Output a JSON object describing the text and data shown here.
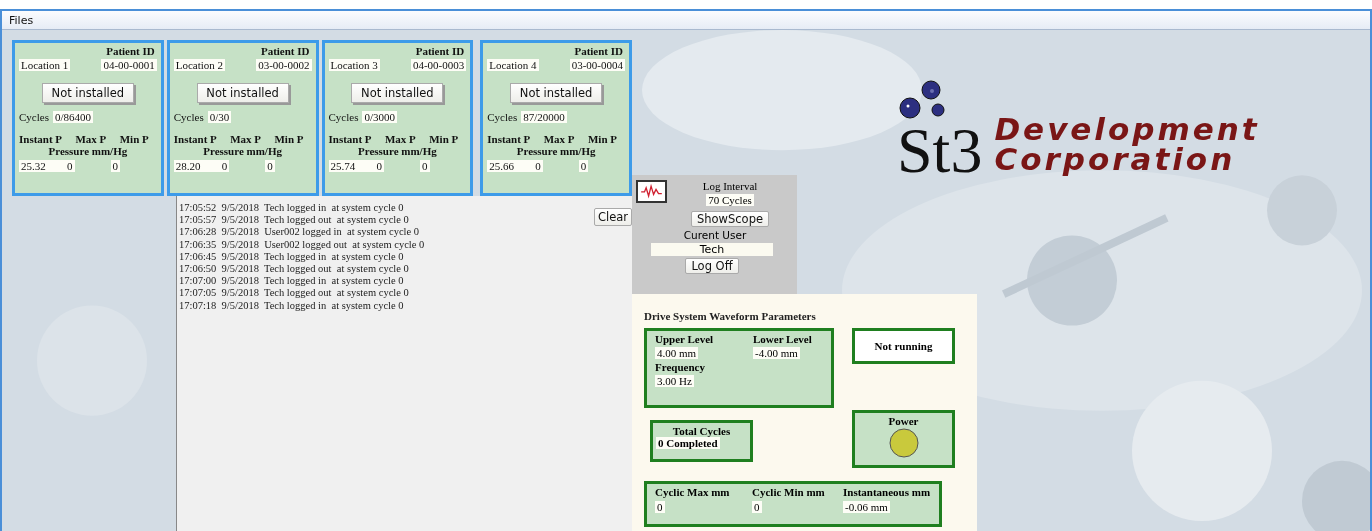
{
  "menu": [
    "Files"
  ],
  "stations": [
    {
      "location": "Location 1",
      "patient_id_label": "Patient ID",
      "patient_id": "04-00-0001",
      "button": "Not installed",
      "cycles_label": "Cycles",
      "cycles": "0/86400",
      "headers": [
        "Instant P",
        "Max P",
        "Min P"
      ],
      "pressure_label": "Pressure mm/Hg",
      "values": [
        "25.32",
        "0",
        "0"
      ]
    },
    {
      "location": "Location 2",
      "patient_id_label": "Patient ID",
      "patient_id": "03-00-0002",
      "button": "Not installed",
      "cycles_label": "Cycles",
      "cycles": "0/30",
      "headers": [
        "Instant P",
        "Max P",
        "Min P"
      ],
      "pressure_label": "Pressure mm/Hg",
      "values": [
        "28.20",
        "0",
        "0"
      ]
    },
    {
      "location": "Location 3",
      "patient_id_label": "Patient ID",
      "patient_id": "04-00-0003",
      "button": "Not installed",
      "cycles_label": "Cycles",
      "cycles": "0/3000",
      "headers": [
        "Instant P",
        "Max P",
        "Min P"
      ],
      "pressure_label": "Pressure mm/Hg",
      "values": [
        "25.74",
        "0",
        "0"
      ]
    },
    {
      "location": "Location 4",
      "patient_id_label": "Patient ID",
      "patient_id": "03-00-0004",
      "button": "Not installed",
      "cycles_label": "Cycles",
      "cycles": "87/20000",
      "headers": [
        "Instant P",
        "Max P",
        "Min P"
      ],
      "pressure_label": "Pressure mm/Hg",
      "values": [
        "25.66",
        "0",
        "0"
      ]
    }
  ],
  "log": {
    "entries": [
      "17:05:52  9/5/2018  Tech logged in  at system cycle 0",
      "17:05:57  9/5/2018  Tech logged out  at system cycle 0",
      "17:06:28  9/5/2018  User002 logged in  at system cycle 0",
      "17:06:35  9/5/2018  User002 logged out  at system cycle 0",
      "17:06:45  9/5/2018  Tech logged in  at system cycle 0",
      "17:06:50  9/5/2018  Tech logged out  at system cycle 0",
      "17:07:00  9/5/2018  Tech logged in  at system cycle 0",
      "17:07:05  9/5/2018  Tech logged out  at system cycle 0",
      "17:07:18  9/5/2018  Tech logged in  at system cycle 0"
    ],
    "clear_button": "Clear"
  },
  "control": {
    "log_interval_label": "Log Interval",
    "log_interval": "70 Cycles",
    "scope_button": "ShowScope",
    "user_label": "Curent User",
    "user": "Tech",
    "logoff_button": "Log Off"
  },
  "drive": {
    "title": "Drive System Waveform Parameters",
    "upper_label": "Upper Level",
    "upper": "4.00 mm",
    "lower_label": "Lower Level",
    "lower": "-4.00 mm",
    "frequency_label": "Frequency",
    "frequency": "3.00 Hz",
    "status": "Not running",
    "power_label": "Power",
    "total_label": "Total Cycles",
    "total": "0 Completed",
    "readouts": [
      {
        "label": "Cyclic Max mm",
        "value": "0"
      },
      {
        "label": "Cyclic Min mm",
        "value": "0"
      },
      {
        "label": "Instantaneous mm",
        "value": "-0.06 mm"
      }
    ]
  },
  "logo": {
    "mark": "St3",
    "lines": [
      "Development",
      "Corporation"
    ]
  }
}
